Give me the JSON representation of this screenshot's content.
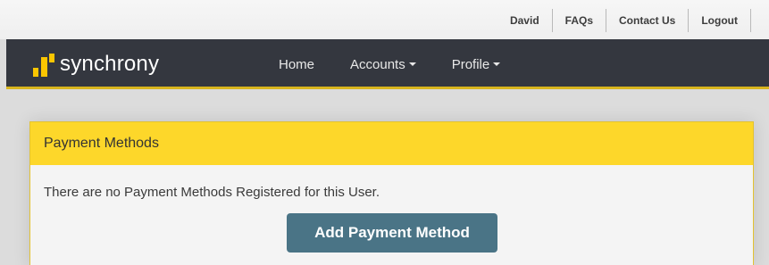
{
  "utility_nav": {
    "user_name": "David",
    "faqs": "FAQs",
    "contact_us": "Contact Us",
    "logout": "Logout"
  },
  "brand": {
    "name": "synchrony",
    "accent_color": "#fbc600",
    "nav_bg_color": "#34373f"
  },
  "main_nav": {
    "home": "Home",
    "accounts": "Accounts",
    "profile": "Profile"
  },
  "panel": {
    "title": "Payment Methods",
    "empty_message": "There are no Payment Methods Registered for this User.",
    "add_button_label": "Add Payment Method",
    "header_color": "#fdd72a",
    "button_color": "#4a7486"
  }
}
